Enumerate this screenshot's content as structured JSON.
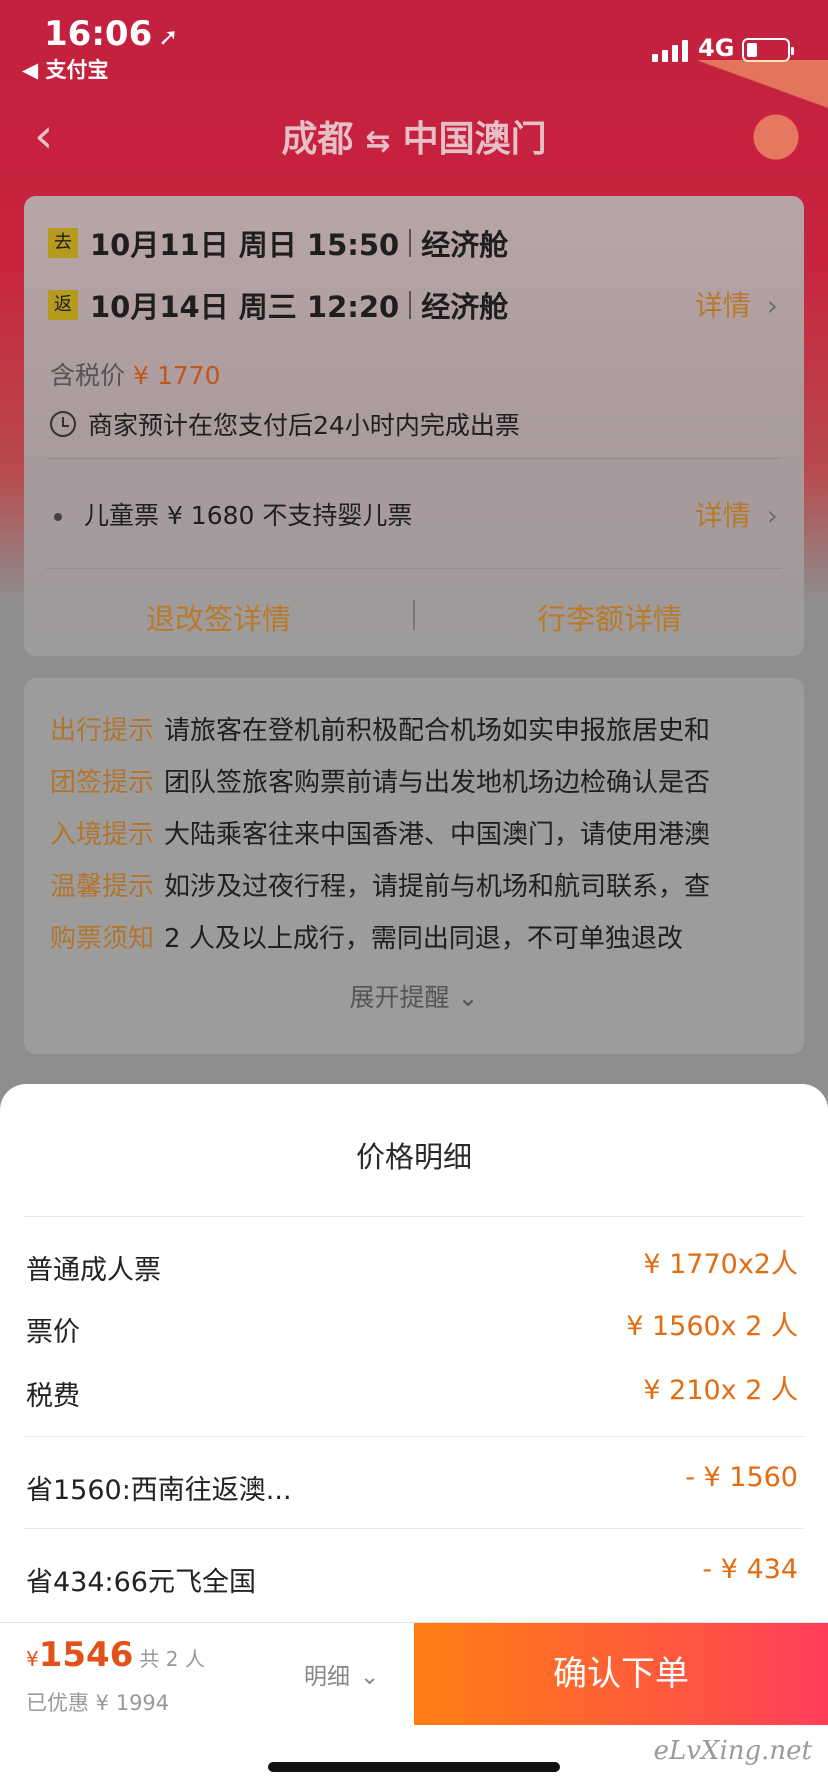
{
  "status_bar": {
    "time": "16:06",
    "back_app": "◀ 支付宝",
    "network": "4G"
  },
  "nav": {
    "origin": "成都",
    "destination": "中国澳门"
  },
  "flight_card": {
    "outbound": {
      "tag": "去",
      "datetime": "10月11日 周日 15:50",
      "cabin": "经济舱"
    },
    "return": {
      "tag": "返",
      "datetime": "10月14日 周三 12:20",
      "cabin": "经济舱"
    },
    "detail_label": "详情",
    "price_label": "含税价",
    "price_value": "¥ 1770",
    "notice": "商家预计在您支付后24小时内完成出票",
    "child_ticket": "儿童票 ¥ 1680   不支持婴儿票",
    "child_detail_label": "详情",
    "refund_link": "退改签详情",
    "baggage_link": "行李额详情"
  },
  "tips": [
    {
      "key": "出行提示",
      "text": "请旅客在登机前积极配合机场如实申报旅居史和"
    },
    {
      "key": "团签提示",
      "text": "团队签旅客购票前请与出发地机场边检确认是否"
    },
    {
      "key": "入境提示",
      "text": "大陆乘客往来中国香港、中国澳门，请使用港澳"
    },
    {
      "key": "温馨提示",
      "text": "如涉及过夜行程，请提前与机场和航司联系，查"
    },
    {
      "key": "购票须知",
      "text": "2 人及以上成行，需同出同退，不可单独退改"
    }
  ],
  "expand_label": "展开提醒",
  "sheet": {
    "title": "价格明细",
    "rows": [
      {
        "label": "普通成人票",
        "value": "¥ 1770x2人"
      },
      {
        "label": "票价",
        "value": "¥  1560x 2 人"
      },
      {
        "label": "税费",
        "value": "¥  210x 2 人"
      }
    ],
    "discounts": [
      {
        "label": "省1560:西南往返澳...",
        "value": "- ¥  1560"
      },
      {
        "label": "省434:66元飞全国",
        "value": "- ¥  434"
      }
    ]
  },
  "bottom_bar": {
    "currency": "¥",
    "total": "1546",
    "count": "共 2 人",
    "saved": "已优惠 ¥ 1994",
    "detail_toggle": "明细",
    "confirm": "确认下单"
  },
  "watermark": "eLvXing.net"
}
